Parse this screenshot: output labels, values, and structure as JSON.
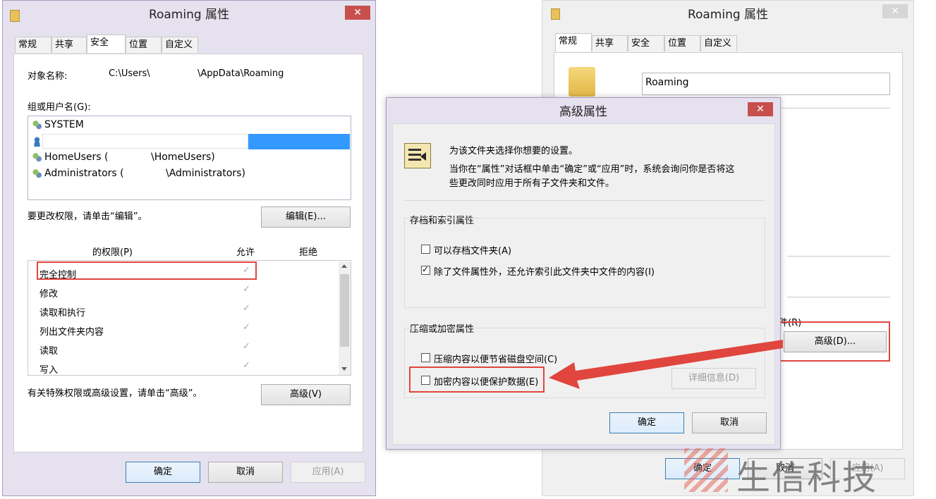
{
  "left_window": {
    "title": "Roaming 属性",
    "close": "✕",
    "tabs": [
      "常规",
      "共享",
      "安全",
      "位置",
      "自定义"
    ],
    "object_label": "对象名称:",
    "object_path_start": "C:\\Users\\",
    "object_path_end": "\\AppData\\Roaming",
    "group_label": "组或用户名(G):",
    "users": [
      "SYSTEM",
      "",
      "HomeUsers (",
      "\\HomeUsers)",
      "Administrators (",
      "\\Administrators)"
    ],
    "edit_hint": "要更改权限，请单击“编辑”。",
    "edit_button": "编辑(E)...",
    "perm_header": "的权限(P)",
    "allow_header": "允许",
    "deny_header": "拒绝",
    "permissions": [
      "完全控制",
      "修改",
      "读取和执行",
      "列出文件夹内容",
      "读取",
      "写入"
    ],
    "check": "✓",
    "advanced_hint": "有关特殊权限或高级设置，请单击“高级”。",
    "advanced_button": "高级(V)",
    "ok": "确定",
    "cancel": "取消",
    "apply": "应用(A)"
  },
  "right_window": {
    "title": "Roaming 属性",
    "close": "✕",
    "tabs": [
      "常规",
      "共享",
      "安全",
      "位置",
      "自定义"
    ],
    "name_value": "Roaming",
    "attr_label_fragment": "件(R)",
    "advanced_button": "高级(D)...",
    "ok": "确定",
    "cancel": "取消",
    "apply": "应用(A)"
  },
  "dialog": {
    "title": "高级属性",
    "close": "✕",
    "intro_line1": "为该文件夹选择你想要的设置。",
    "intro_line2": "当你在“属性”对话框中单击“确定”或“应用”时，系统会询问你是否将这",
    "intro_line3": "些更改同时应用于所有子文件夹和文件。",
    "group1_title": "存档和索引属性",
    "archive_label": "可以存档文件夹(A)",
    "index_label": "除了文件属性外，还允许索引此文件夹中文件的内容(I)",
    "group2_title": "压缩或加密属性",
    "compress_label": "压缩内容以便节省磁盘空间(C)",
    "encrypt_label": "加密内容以便保护数据(E)",
    "details_button": "详细信息(D)",
    "ok": "确定",
    "cancel": "取消",
    "states": {
      "archive": false,
      "index": true,
      "compress": false,
      "encrypt": false
    }
  },
  "watermark": {
    "text": "生信科技"
  },
  "colors": {
    "accent_red": "#e0463e",
    "selection_blue": "#3399ff",
    "close_red": "#c7504d"
  }
}
